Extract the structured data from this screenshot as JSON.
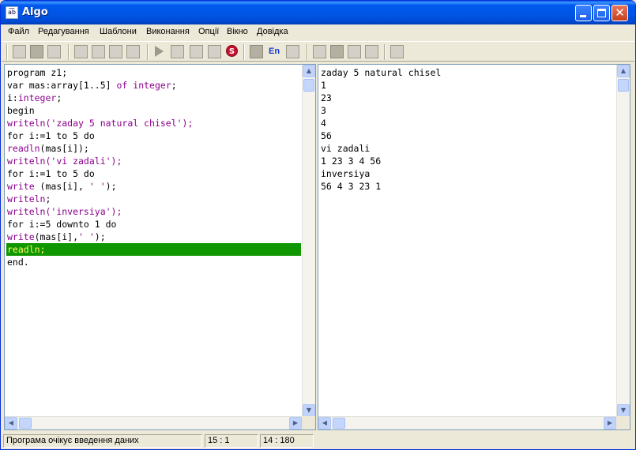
{
  "window": {
    "title": "Algo",
    "app_icon_text": "a͞b"
  },
  "menu": [
    "Файл",
    "Редагування",
    "Шаблони",
    "Виконання",
    "Опції",
    "Вікно",
    "Довідка"
  ],
  "toolbar": {
    "language_label": "En",
    "stop_label": "S"
  },
  "editor": {
    "lines": [
      {
        "segments": [
          {
            "t": "program z1;",
            "c": "kw"
          }
        ]
      },
      {
        "segments": [
          {
            "t": "var mas:array[1..5] ",
            "c": "kw"
          },
          {
            "t": "of",
            "c": "purple"
          },
          {
            "t": " ",
            "c": "kw"
          },
          {
            "t": "integer",
            "c": "purple"
          },
          {
            "t": ";",
            "c": "kw"
          }
        ]
      },
      {
        "segments": [
          {
            "t": "i:",
            "c": "kw"
          },
          {
            "t": "integer",
            "c": "purple"
          },
          {
            "t": ";",
            "c": "kw"
          }
        ]
      },
      {
        "segments": [
          {
            "t": "begin",
            "c": "kw"
          }
        ]
      },
      {
        "segments": [
          {
            "t": "writeln",
            "c": "purple"
          },
          {
            "t": "('zaday 5 natural chisel');",
            "c": "str"
          }
        ]
      },
      {
        "segments": [
          {
            "t": "for i:=1 to 5 do",
            "c": "kw"
          }
        ]
      },
      {
        "segments": [
          {
            "t": "readln",
            "c": "purple"
          },
          {
            "t": "(mas[i]);",
            "c": "kw"
          }
        ]
      },
      {
        "segments": [
          {
            "t": "writeln",
            "c": "purple"
          },
          {
            "t": "('vi zadali');",
            "c": "str"
          }
        ]
      },
      {
        "segments": [
          {
            "t": "for i:=1 to 5 do",
            "c": "kw"
          }
        ]
      },
      {
        "segments": [
          {
            "t": "write",
            "c": "purple"
          },
          {
            "t": " (mas[i], ",
            "c": "kw"
          },
          {
            "t": "' '",
            "c": "str"
          },
          {
            "t": ");",
            "c": "kw"
          }
        ]
      },
      {
        "segments": [
          {
            "t": "writeln",
            "c": "purple"
          },
          {
            "t": ";",
            "c": "kw"
          }
        ]
      },
      {
        "segments": [
          {
            "t": "writeln",
            "c": "purple"
          },
          {
            "t": "('inversiya');",
            "c": "str"
          }
        ]
      },
      {
        "segments": [
          {
            "t": "for i:=5 downto 1 do",
            "c": "kw"
          }
        ]
      },
      {
        "segments": [
          {
            "t": "write",
            "c": "purple"
          },
          {
            "t": "(mas[i],",
            "c": "kw"
          },
          {
            "t": "' '",
            "c": "str"
          },
          {
            "t": ");",
            "c": "kw"
          }
        ]
      },
      {
        "segments": [
          {
            "t": "readln;",
            "c": "kw"
          }
        ],
        "highlighted": true
      },
      {
        "segments": [
          {
            "t": "end.",
            "c": "kw"
          }
        ]
      }
    ],
    "highlight_color": "#0f9600"
  },
  "output": {
    "lines": [
      "zaday 5 natural chisel",
      "1",
      "23",
      "3",
      "4",
      "56",
      "vi zadali",
      "1 23 3 4 56",
      "inversiya",
      "56 4 3 23 1"
    ]
  },
  "status": {
    "message": "Програма очікує введення даних",
    "cursor_pos": "15 :  1",
    "counter": "14 : 180"
  }
}
